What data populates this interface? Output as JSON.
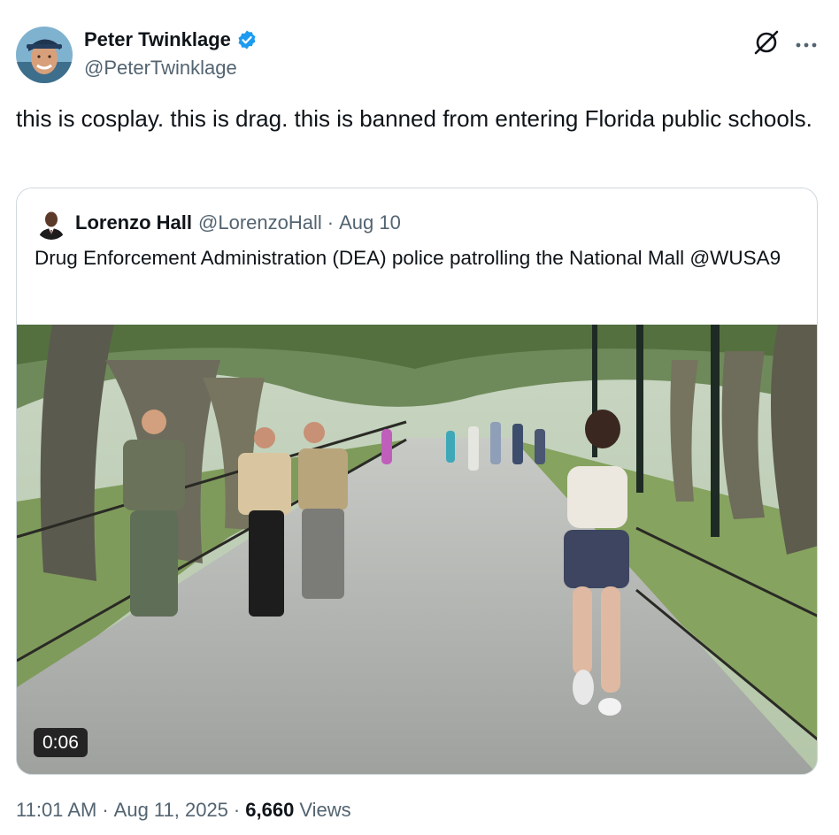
{
  "author": {
    "display_name": "Peter Twinklage",
    "handle": "@PeterTwinklage",
    "verified": true
  },
  "icons": {
    "verified": "verified-badge-icon",
    "grok": "grok-icon",
    "more": "more-options-icon"
  },
  "colors": {
    "verified_blue": "#1d9bf0",
    "secondary_text": "#536471",
    "primary_text": "#0f1419",
    "border": "#cfd9de"
  },
  "tweet": {
    "text": "this is cosplay. this is drag. this is banned from entering Florida public schools."
  },
  "quoted": {
    "display_name": "Lorenzo Hall",
    "handle": "@LorenzoHall",
    "separator": "·",
    "date": "Aug 10",
    "text": "Drug Enforcement Administration (DEA) police patrolling the National Mall @WUSA9",
    "video_duration": "0:06"
  },
  "meta": {
    "time": "11:01 AM",
    "separator": "·",
    "date": "Aug 11, 2025",
    "views_count": "6,660",
    "views_label": "Views"
  }
}
